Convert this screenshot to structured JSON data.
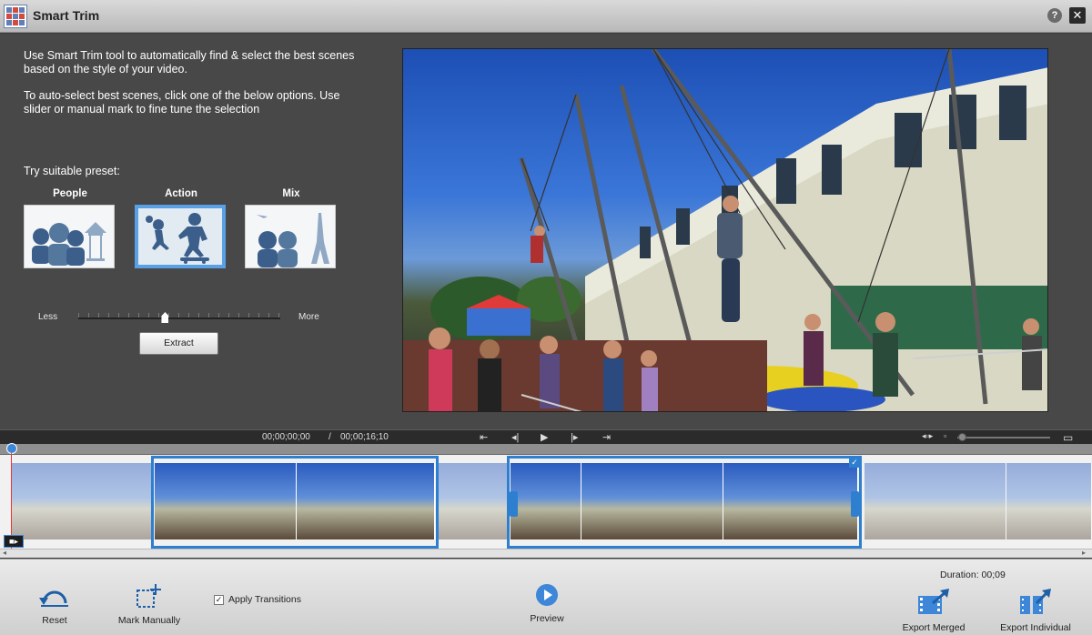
{
  "window": {
    "title": "Smart Trim",
    "help": "?",
    "close": "✕"
  },
  "instructions": {
    "line1": "Use Smart Trim tool to automatically find & select the best scenes based on the style of your video.",
    "line2": "To auto-select best scenes, click one of the below options. Use slider or manual mark to fine tune the selection"
  },
  "presets": {
    "label": "Try suitable preset:",
    "items": [
      {
        "label": "People",
        "selected": false
      },
      {
        "label": "Action",
        "selected": true
      },
      {
        "label": "Mix",
        "selected": false
      }
    ]
  },
  "slider": {
    "less": "Less",
    "more": "More",
    "value_fraction": 0.43
  },
  "extract_label": "Extract",
  "transport": {
    "current": "00;00;00;00",
    "separator": "/",
    "total": "00;00;16;10"
  },
  "toolbar": {
    "reset": "Reset",
    "mark_manually": "Mark Manually",
    "apply_transitions": "Apply Transitions",
    "apply_checked": true,
    "preview": "Preview",
    "duration": "Duration: 00;09",
    "export_merged": "Export Merged",
    "export_individual": "Export Individual"
  },
  "colors": {
    "accent": "#2e7fd0",
    "panel": "#484848"
  }
}
